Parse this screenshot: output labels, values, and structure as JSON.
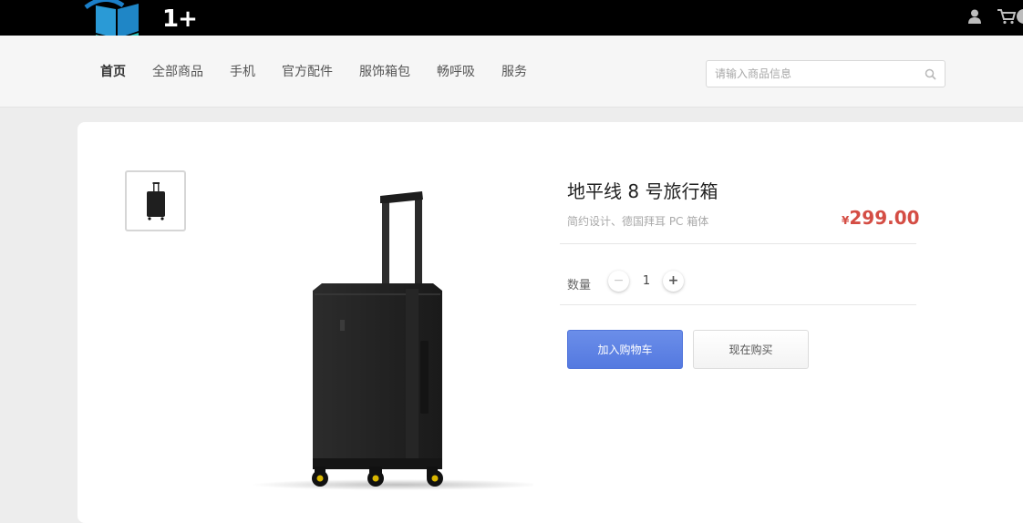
{
  "header": {
    "logo_text": "1+",
    "icons": {
      "user": "user-icon",
      "cart": "cart-icon"
    }
  },
  "nav": {
    "items": [
      "首页",
      "全部商品",
      "手机",
      "官方配件",
      "服饰箱包",
      "畅呼吸",
      "服务"
    ],
    "active": "首页"
  },
  "search": {
    "placeholder": "请输入商品信息",
    "value": "",
    "icon": "search-icon"
  },
  "product": {
    "title": "地平线 8 号旅行箱",
    "subtitle": "简约设计、德国拜耳 PC 箱体",
    "price_currency": "¥",
    "price": "299.00",
    "quantity_label": "数量",
    "quantity": "1",
    "minus": "−",
    "plus": "+",
    "add_to_cart": "加入购物车",
    "buy_now": "现在购买"
  },
  "colors": {
    "accent": "#5479e0",
    "price": "#d44d44",
    "topbar": "#000000"
  }
}
